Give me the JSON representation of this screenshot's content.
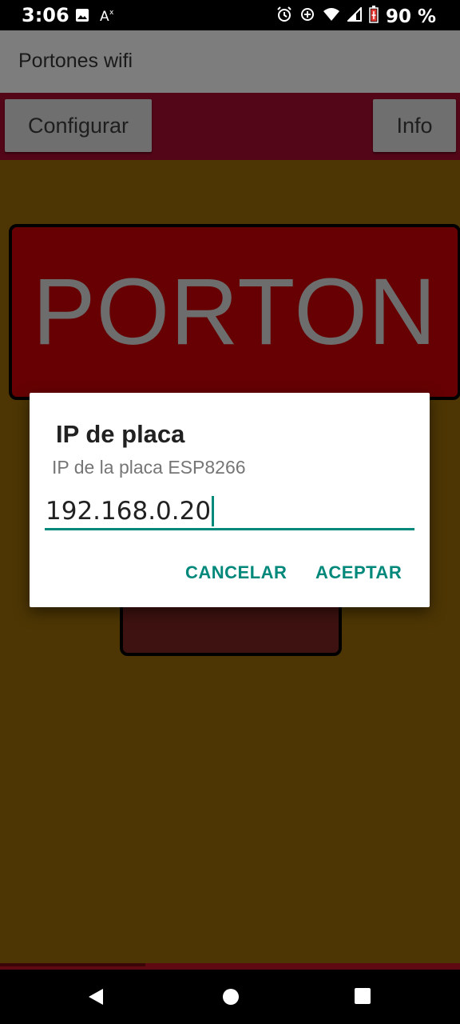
{
  "status_bar": {
    "time": "3:06",
    "battery": "90 %",
    "icons": [
      "image-icon",
      "font-accessibility-icon",
      "alarm-icon",
      "sync-icon",
      "wifi-icon",
      "signal-icon",
      "battery-icon"
    ]
  },
  "app_bar": {
    "title": "Portones wifi"
  },
  "toolbar": {
    "config_label": "Configurar",
    "info_label": "Info"
  },
  "main": {
    "porton_label": "PORTON"
  },
  "dialog": {
    "title": "IP de placa",
    "message": "IP de la placa ESP8266",
    "input_value": "192.168.0.20",
    "cancel_label": "CANCELAR",
    "accept_label": "ACEPTAR"
  },
  "nav_bar": {
    "icons": [
      "back-icon",
      "home-icon",
      "recents-icon"
    ]
  },
  "colors": {
    "accent": "#00897b",
    "background": "#4d3604",
    "toolbar": "#530617",
    "porton_button": "#660003"
  }
}
